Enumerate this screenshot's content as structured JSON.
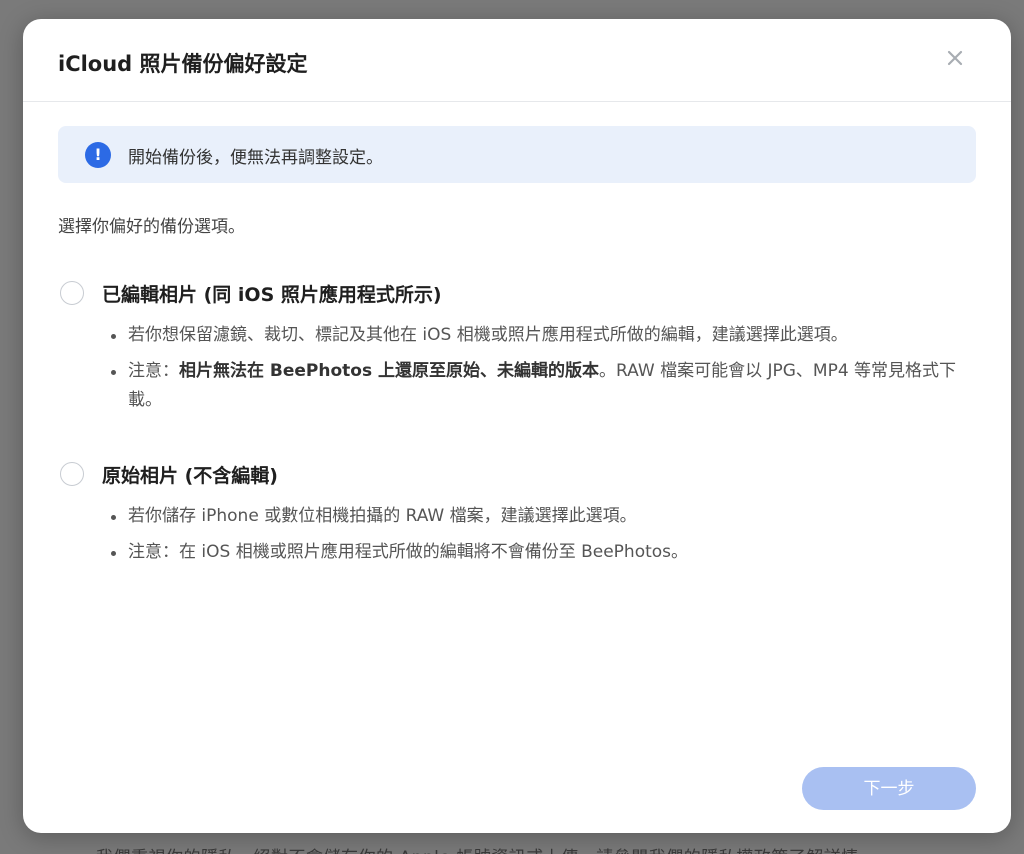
{
  "backdrop": {
    "partial_text": "我們重視你的隱私，絕對不會儲存你的 Apple 帳號資訊或上傳，請參閱我們的隱私權政策了解詳情"
  },
  "dialog": {
    "title": "iCloud 照片備份偏好設定",
    "close_label": "×",
    "notice": {
      "icon": "exclamation-info-icon",
      "text": "開始備份後，便無法再調整設定。"
    },
    "intro": "選擇你偏好的備份選項。",
    "options": [
      {
        "title": "已編輯相片 (同 iOS 照片應用程式所示)",
        "selected": false,
        "bullets": [
          {
            "text": "若你想保留濾鏡、裁切、標記及其他在 iOS 相機或照片應用程式所做的編輯，建議選擇此選項。"
          },
          {
            "prefix": "注意：",
            "bold": "相片無法在 BeePhotos 上還原至原始、未編輯的版本",
            "suffix": "。RAW 檔案可能會以 JPG、MP4 等常見格式下載。"
          }
        ]
      },
      {
        "title": "原始相片 (不含編輯)",
        "selected": false,
        "bullets": [
          {
            "text": "若你儲存 iPhone 或數位相機拍攝的 RAW 檔案，建議選擇此選項。"
          },
          {
            "text": "注意：在 iOS 相機或照片應用程式所做的編輯將不會備份至 BeePhotos。"
          }
        ]
      }
    ],
    "next_button": {
      "label": "下一步",
      "enabled": false
    }
  },
  "colors": {
    "accent": "#2c6ae5",
    "notice_bg": "#e9f0fb",
    "button_disabled": "#a9c0f2"
  }
}
